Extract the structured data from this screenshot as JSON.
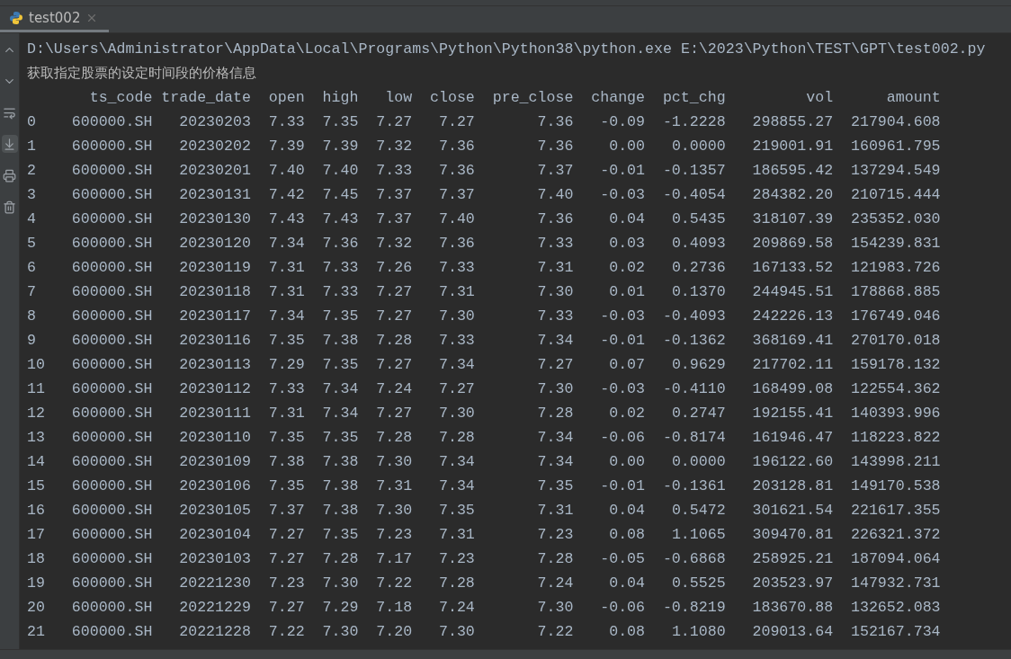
{
  "tabs": [
    {
      "label": "test002",
      "selected": true
    }
  ],
  "console": {
    "command": "D:\\Users\\Administrator\\AppData\\Local\\Programs\\Python\\Python38\\python.exe E:\\2023\\Python\\TEST\\GPT\\test002.py",
    "message": "获取指定股票的设定时间段的价格信息",
    "columns": [
      "",
      "ts_code",
      "trade_date",
      "open",
      "high",
      "low",
      "close",
      "pre_close",
      "change",
      "pct_chg",
      "vol",
      "amount"
    ],
    "rows": [
      [
        "0",
        "600000.SH",
        "20230203",
        "7.33",
        "7.35",
        "7.27",
        "7.27",
        "7.36",
        "-0.09",
        "-1.2228",
        "298855.27",
        "217904.608"
      ],
      [
        "1",
        "600000.SH",
        "20230202",
        "7.39",
        "7.39",
        "7.32",
        "7.36",
        "7.36",
        "0.00",
        "0.0000",
        "219001.91",
        "160961.795"
      ],
      [
        "2",
        "600000.SH",
        "20230201",
        "7.40",
        "7.40",
        "7.33",
        "7.36",
        "7.37",
        "-0.01",
        "-0.1357",
        "186595.42",
        "137294.549"
      ],
      [
        "3",
        "600000.SH",
        "20230131",
        "7.42",
        "7.45",
        "7.37",
        "7.37",
        "7.40",
        "-0.03",
        "-0.4054",
        "284382.20",
        "210715.444"
      ],
      [
        "4",
        "600000.SH",
        "20230130",
        "7.43",
        "7.43",
        "7.37",
        "7.40",
        "7.36",
        "0.04",
        "0.5435",
        "318107.39",
        "235352.030"
      ],
      [
        "5",
        "600000.SH",
        "20230120",
        "7.34",
        "7.36",
        "7.32",
        "7.36",
        "7.33",
        "0.03",
        "0.4093",
        "209869.58",
        "154239.831"
      ],
      [
        "6",
        "600000.SH",
        "20230119",
        "7.31",
        "7.33",
        "7.26",
        "7.33",
        "7.31",
        "0.02",
        "0.2736",
        "167133.52",
        "121983.726"
      ],
      [
        "7",
        "600000.SH",
        "20230118",
        "7.31",
        "7.33",
        "7.27",
        "7.31",
        "7.30",
        "0.01",
        "0.1370",
        "244945.51",
        "178868.885"
      ],
      [
        "8",
        "600000.SH",
        "20230117",
        "7.34",
        "7.35",
        "7.27",
        "7.30",
        "7.33",
        "-0.03",
        "-0.4093",
        "242226.13",
        "176749.046"
      ],
      [
        "9",
        "600000.SH",
        "20230116",
        "7.35",
        "7.38",
        "7.28",
        "7.33",
        "7.34",
        "-0.01",
        "-0.1362",
        "368169.41",
        "270170.018"
      ],
      [
        "10",
        "600000.SH",
        "20230113",
        "7.29",
        "7.35",
        "7.27",
        "7.34",
        "7.27",
        "0.07",
        "0.9629",
        "217702.11",
        "159178.132"
      ],
      [
        "11",
        "600000.SH",
        "20230112",
        "7.33",
        "7.34",
        "7.24",
        "7.27",
        "7.30",
        "-0.03",
        "-0.4110",
        "168499.08",
        "122554.362"
      ],
      [
        "12",
        "600000.SH",
        "20230111",
        "7.31",
        "7.34",
        "7.27",
        "7.30",
        "7.28",
        "0.02",
        "0.2747",
        "192155.41",
        "140393.996"
      ],
      [
        "13",
        "600000.SH",
        "20230110",
        "7.35",
        "7.35",
        "7.28",
        "7.28",
        "7.34",
        "-0.06",
        "-0.8174",
        "161946.47",
        "118223.822"
      ],
      [
        "14",
        "600000.SH",
        "20230109",
        "7.38",
        "7.38",
        "7.30",
        "7.34",
        "7.34",
        "0.00",
        "0.0000",
        "196122.60",
        "143998.211"
      ],
      [
        "15",
        "600000.SH",
        "20230106",
        "7.35",
        "7.38",
        "7.31",
        "7.34",
        "7.35",
        "-0.01",
        "-0.1361",
        "203128.81",
        "149170.538"
      ],
      [
        "16",
        "600000.SH",
        "20230105",
        "7.37",
        "7.38",
        "7.30",
        "7.35",
        "7.31",
        "0.04",
        "0.5472",
        "301621.54",
        "221617.355"
      ],
      [
        "17",
        "600000.SH",
        "20230104",
        "7.27",
        "7.35",
        "7.23",
        "7.31",
        "7.23",
        "0.08",
        "1.1065",
        "309470.81",
        "226321.372"
      ],
      [
        "18",
        "600000.SH",
        "20230103",
        "7.27",
        "7.28",
        "7.17",
        "7.23",
        "7.28",
        "-0.05",
        "-0.6868",
        "258925.21",
        "187094.064"
      ],
      [
        "19",
        "600000.SH",
        "20221230",
        "7.23",
        "7.30",
        "7.22",
        "7.28",
        "7.24",
        "0.04",
        "0.5525",
        "203523.97",
        "147932.731"
      ],
      [
        "20",
        "600000.SH",
        "20221229",
        "7.27",
        "7.29",
        "7.18",
        "7.24",
        "7.30",
        "-0.06",
        "-0.8219",
        "183670.88",
        "132652.083"
      ],
      [
        "21",
        "600000.SH",
        "20221228",
        "7.22",
        "7.30",
        "7.20",
        "7.30",
        "7.22",
        "0.08",
        "1.1080",
        "209013.64",
        "152167.734"
      ]
    ]
  }
}
